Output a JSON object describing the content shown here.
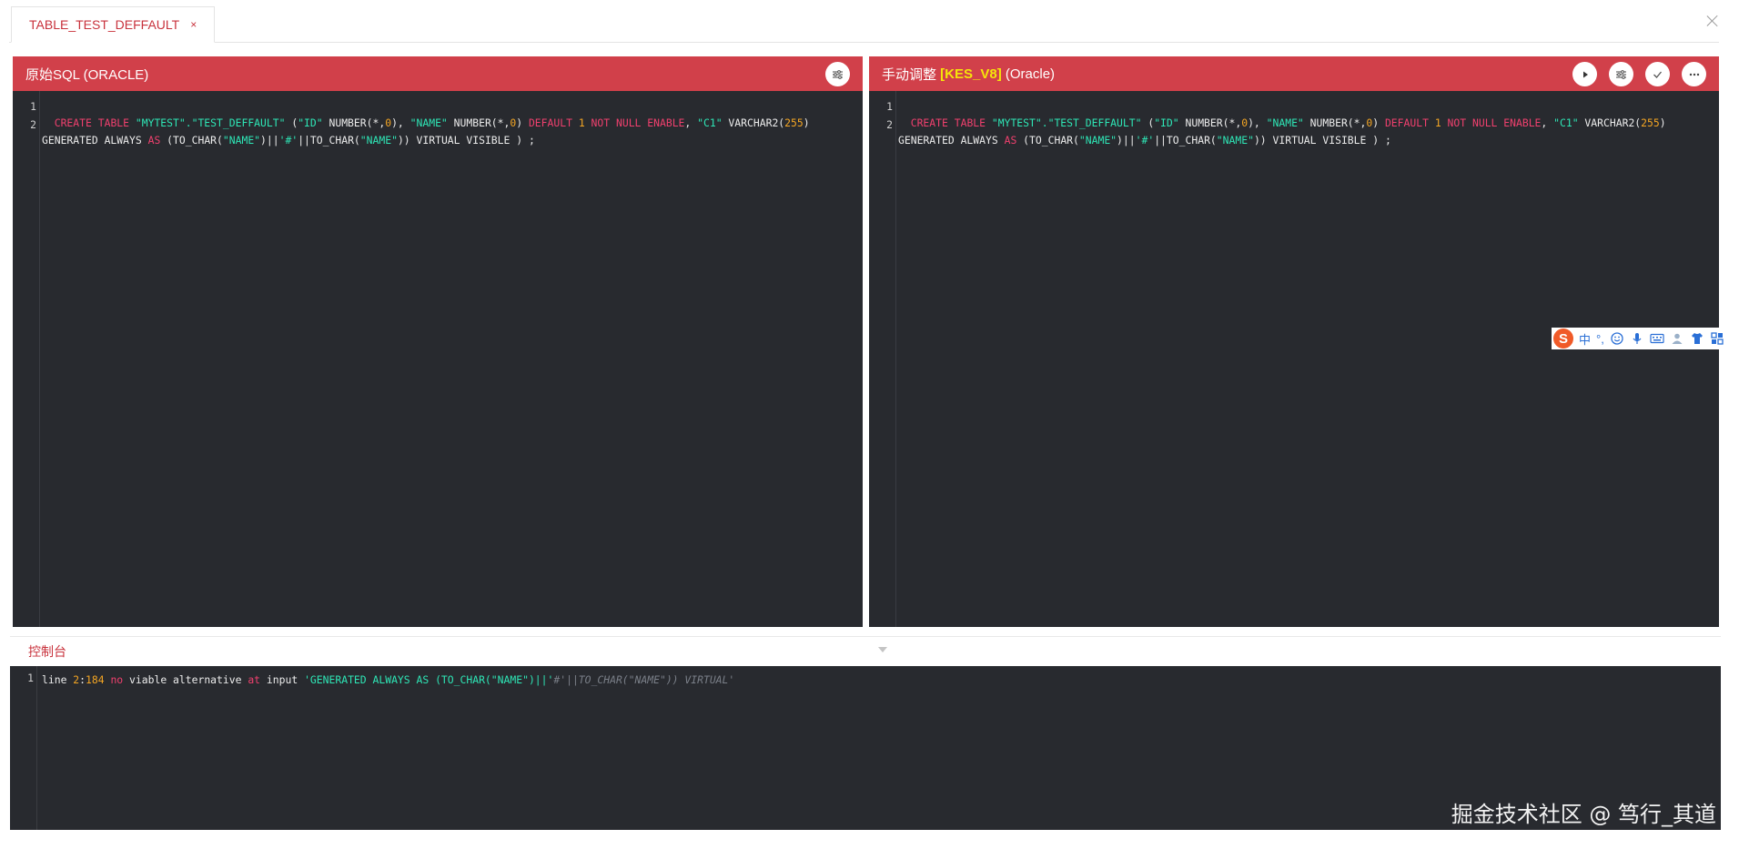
{
  "tab": {
    "label": "TABLE_TEST_DEFFAULT",
    "close": "×"
  },
  "left_panel": {
    "title": "原始SQL (ORACLE)"
  },
  "right_panel": {
    "title_prefix": "手动调整 ",
    "title_highlight": "[KES_V8]",
    "title_suffix": " (Oracle)"
  },
  "editor": {
    "line_numbers": [
      "1",
      "2"
    ],
    "line1": "",
    "line2_tokens": [
      {
        "t": "  ",
        "c": "plain"
      },
      {
        "t": "CREATE TABLE ",
        "c": "kw"
      },
      {
        "t": "\"MYTEST\".\"TEST_DEFFAULT\"",
        "c": "str"
      },
      {
        "t": " (",
        "c": "plain"
      },
      {
        "t": "\"ID\"",
        "c": "str"
      },
      {
        "t": " NUMBER(*,",
        "c": "plain"
      },
      {
        "t": "0",
        "c": "num"
      },
      {
        "t": "), ",
        "c": "plain"
      },
      {
        "t": "\"NAME\"",
        "c": "str"
      },
      {
        "t": " NUMBER(*,",
        "c": "plain"
      },
      {
        "t": "0",
        "c": "num"
      },
      {
        "t": ") ",
        "c": "plain"
      },
      {
        "t": "DEFAULT ",
        "c": "kw"
      },
      {
        "t": "1",
        "c": "num"
      },
      {
        "t": " NOT NULL ENABLE",
        "c": "kw"
      },
      {
        "t": ", ",
        "c": "plain"
      },
      {
        "t": "\"C1\"",
        "c": "str"
      },
      {
        "t": " VARCHAR2(",
        "c": "plain"
      },
      {
        "t": "255",
        "c": "num"
      },
      {
        "t": ")",
        "c": "plain"
      }
    ],
    "line2_wrap_tokens": [
      {
        "t": "GENERATED ALWAYS ",
        "c": "plain"
      },
      {
        "t": "AS",
        "c": "kw"
      },
      {
        "t": " (TO_CHAR(",
        "c": "plain"
      },
      {
        "t": "\"NAME\"",
        "c": "str"
      },
      {
        "t": ")||",
        "c": "plain"
      },
      {
        "t": "'#'",
        "c": "str"
      },
      {
        "t": "||TO_CHAR(",
        "c": "plain"
      },
      {
        "t": "\"NAME\"",
        "c": "str"
      },
      {
        "t": ")) VIRTUAL VISIBLE ) ;",
        "c": "plain"
      }
    ]
  },
  "console": {
    "title": "控制台",
    "line_number": "1",
    "tokens": [
      {
        "t": "line ",
        "c": "plain"
      },
      {
        "t": "2",
        "c": "num"
      },
      {
        "t": ":",
        "c": "plain"
      },
      {
        "t": "184",
        "c": "num"
      },
      {
        "t": " ",
        "c": "plain"
      },
      {
        "t": "no",
        "c": "kw"
      },
      {
        "t": " viable alternative ",
        "c": "plain"
      },
      {
        "t": "at",
        "c": "kw"
      },
      {
        "t": " input ",
        "c": "plain"
      },
      {
        "t": "'GENERATED ALWAYS AS (TO_CHAR(\"NAME\")||'",
        "c": "str"
      },
      {
        "t": "#'||TO_CHAR(\"NAME\")) VIRTUAL'",
        "c": "cmt"
      }
    ]
  },
  "ime": {
    "logo": "S",
    "lang": "中",
    "punct": "°,"
  },
  "watermark": "掘金技术社区 @ 笃行_其道",
  "colors": {
    "header_red": "#d1404a",
    "editor_bg": "#282a2f",
    "keyword": "#f0406e",
    "string": "#2ee6b6",
    "number": "#f5a623",
    "highlight_yellow": "#f5e50a"
  }
}
